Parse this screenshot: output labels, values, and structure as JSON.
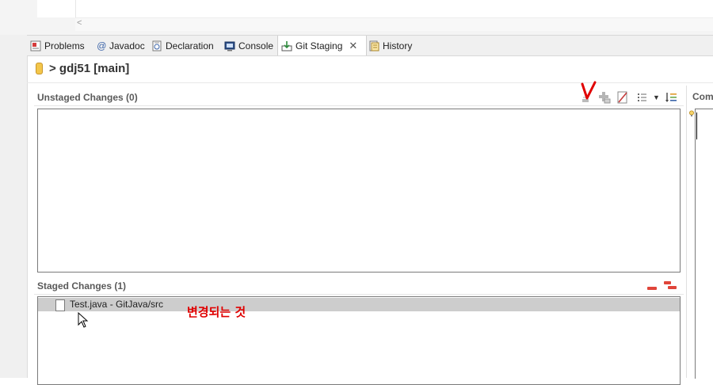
{
  "tabs": [
    {
      "label": "Problems",
      "icon": "problems-icon"
    },
    {
      "label": "Javadoc",
      "icon": "at-icon"
    },
    {
      "label": "Declaration",
      "icon": "declaration-icon"
    },
    {
      "label": "Console",
      "icon": "console-icon"
    },
    {
      "label": "Git Staging",
      "icon": "git-staging-icon",
      "active": true
    },
    {
      "label": "History",
      "icon": "history-icon"
    }
  ],
  "repo": {
    "title": "> gdj51 [main]"
  },
  "unstaged": {
    "title": "Unstaged Changes (0)"
  },
  "staged": {
    "title": "Staged Changes (1)",
    "items": [
      {
        "label": "Test.java - GitJava/src"
      }
    ]
  },
  "commit": {
    "label": "Com"
  },
  "annotation": {
    "text": "변경되는 것"
  },
  "colors": {
    "annotation": "#e00000",
    "selected_row": "#cdcdcd",
    "unstage_icon": "#e0453a"
  }
}
